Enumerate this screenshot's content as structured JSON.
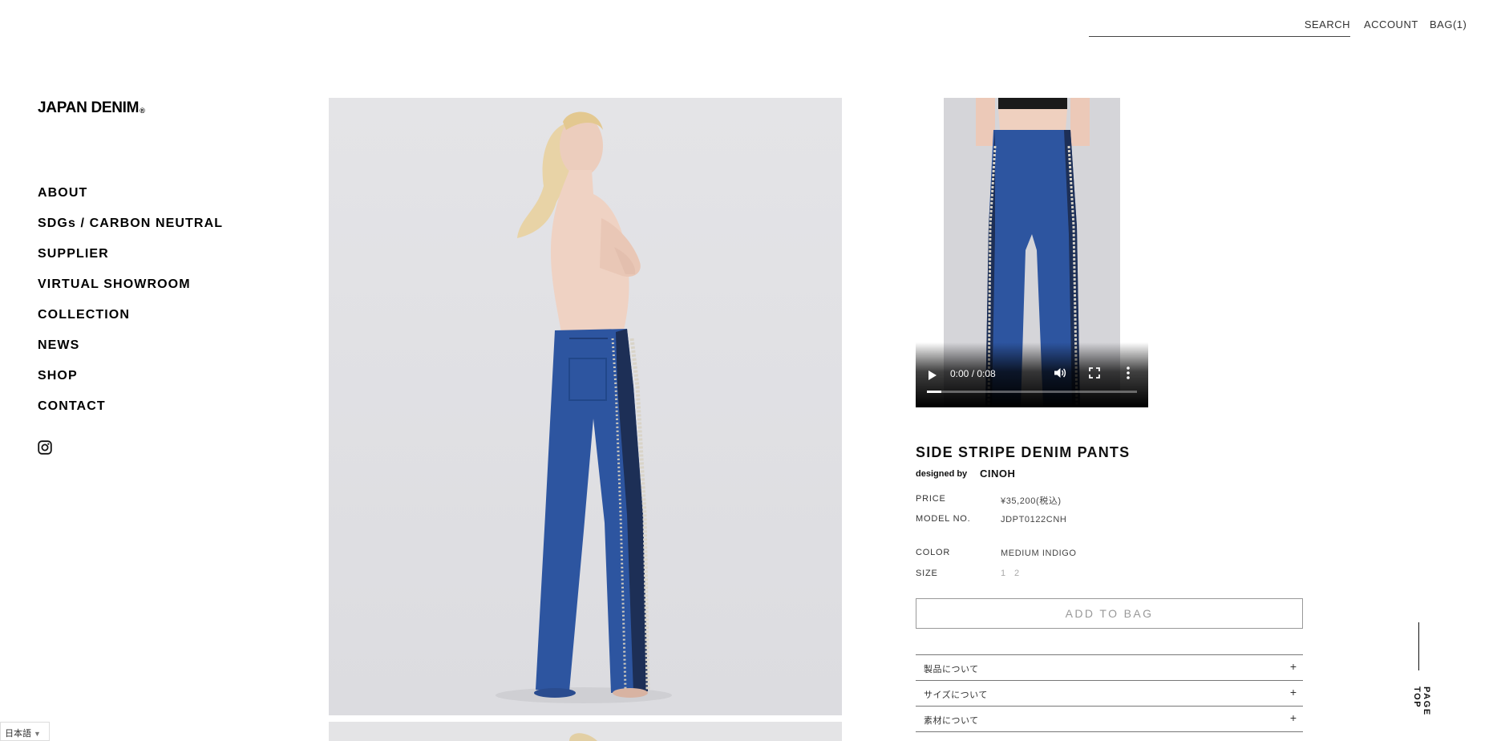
{
  "header": {
    "search_placeholder": "",
    "search_label": "SEARCH",
    "account_label": "ACCOUNT",
    "bag_label": "BAG(1)"
  },
  "brand": {
    "logo_text": "JAPAN DENIM",
    "logo_mark": "®"
  },
  "nav": {
    "items": [
      "ABOUT",
      "SDGs / CARBON NEUTRAL",
      "SUPPLIER",
      "VIRTUAL SHOWROOM",
      "COLLECTION",
      "NEWS",
      "SHOP",
      "CONTACT"
    ],
    "social_icon": "instagram-icon"
  },
  "video": {
    "time": "0:00 / 0:08",
    "progress": 0.07
  },
  "product": {
    "title": "SIDE STRIPE DENIM PANTS",
    "designed_by_label": "designed by",
    "designer": "CINOH",
    "price_label": "PRICE",
    "price": "¥35,200(税込)",
    "model_label": "MODEL NO.",
    "model": "JDPT0122CNH",
    "color_label": "COLOR",
    "color": "MEDIUM INDIGO",
    "size_label": "SIZE",
    "sizes": [
      "1",
      "2"
    ],
    "add_to_bag": "ADD TO BAG",
    "accordions": [
      "製品について",
      "サイズについて",
      "素材について"
    ],
    "accordion_icon": "+"
  },
  "page_top": "PAGE TOP",
  "language": {
    "current": "日本語",
    "arrow": "▼"
  },
  "colors": {
    "text": "#111111",
    "photo_bg": "#e1e1e4",
    "denim": "#2d55a0",
    "border": "#777777",
    "muted": "#999999"
  }
}
